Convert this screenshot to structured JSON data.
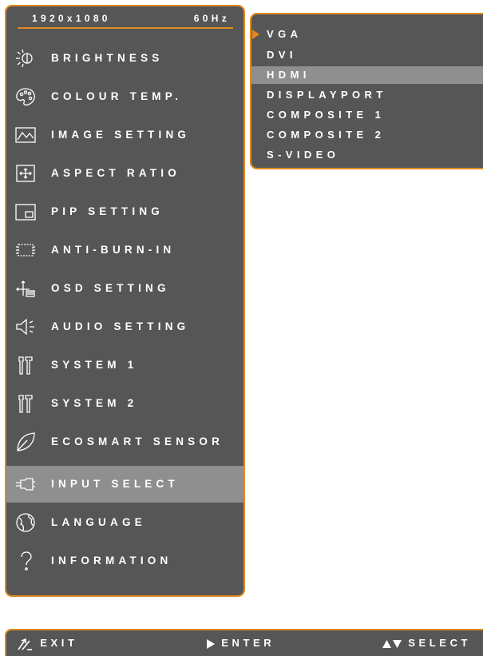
{
  "header": {
    "resolution": "1920x1080",
    "refresh_rate": "60Hz"
  },
  "main_menu": {
    "items": [
      {
        "label": "BRIGHTNESS",
        "icon": "brightness-icon"
      },
      {
        "label": "COLOUR TEMP.",
        "icon": "palette-icon"
      },
      {
        "label": "IMAGE SETTING",
        "icon": "image-icon"
      },
      {
        "label": "ASPECT RATIO",
        "icon": "aspect-ratio-icon"
      },
      {
        "label": "PIP SETTING",
        "icon": "pip-icon"
      },
      {
        "label": "ANTI-BURN-IN",
        "icon": "anti-burn-in-icon"
      },
      {
        "label": "OSD SETTING",
        "icon": "osd-icon"
      },
      {
        "label": "AUDIO SETTING",
        "icon": "speaker-icon"
      },
      {
        "label": "SYSTEM 1",
        "icon": "tools-icon"
      },
      {
        "label": "SYSTEM 2",
        "icon": "tools-icon"
      },
      {
        "label": "ECOSMART SENSOR",
        "icon": "leaf-icon"
      },
      {
        "label": "INPUT SELECT",
        "icon": "plug-icon",
        "selected": true
      },
      {
        "label": "LANGUAGE",
        "icon": "globe-icon"
      },
      {
        "label": "INFORMATION",
        "icon": "question-icon"
      }
    ]
  },
  "submenu": {
    "items": [
      {
        "label": "VGA",
        "pointer": true
      },
      {
        "label": "DVI"
      },
      {
        "label": "HDMI",
        "highlighted": true
      },
      {
        "label": "DISPLAYPORT"
      },
      {
        "label": "COMPOSITE 1"
      },
      {
        "label": "COMPOSITE 2"
      },
      {
        "label": "S-VIDEO"
      }
    ]
  },
  "footer": {
    "exit_label": "EXIT",
    "enter_label": "ENTER",
    "select_label": "SELECT"
  },
  "colors": {
    "panel": "#565656",
    "border": "#e08a1e",
    "highlight": "#8f8f8f",
    "text": "#ffffff"
  }
}
